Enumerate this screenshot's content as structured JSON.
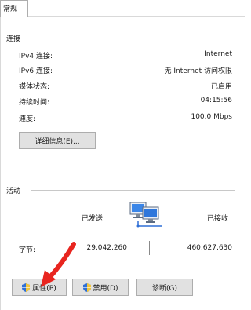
{
  "tab": {
    "label": "常规"
  },
  "connection": {
    "title": "连接",
    "rows": [
      {
        "key": "IPv4 连接:",
        "value": "Internet"
      },
      {
        "key": "IPv6 连接:",
        "value": "无 Internet 访问权限"
      },
      {
        "key": "媒体状态:",
        "value": "已启用"
      },
      {
        "key": "持续时间:",
        "value": "04:15:56"
      },
      {
        "key": "速度:",
        "value": "100.0 Mbps"
      }
    ],
    "details_button": "详细信息(E)..."
  },
  "activity": {
    "title": "活动",
    "sent_label": "已发送",
    "received_label": "已接收",
    "bytes_label": "字节:",
    "bytes_sent": "29,042,260",
    "bytes_received": "460,627,630"
  },
  "buttons": {
    "properties": "属性(P)",
    "disable": "禁用(D)",
    "diagnose": "诊断(G)"
  },
  "colors": {
    "annotation_arrow": "#e8251f",
    "shield_blue": "#2f6fd6",
    "shield_yellow": "#f3c63a"
  }
}
